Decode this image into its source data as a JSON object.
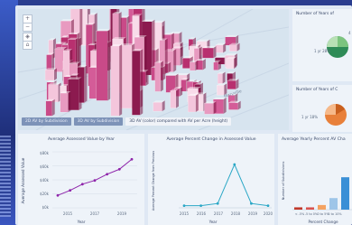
{
  "map": {
    "tabs": [
      "2D AV by Subdivision",
      "3D AV by Subdivision",
      "3D AV (color) compared with AV per Acre (height)"
    ],
    "active_tab": 2,
    "street_label": "Maryville"
  },
  "side_panels": {
    "top_title": "Number of Years of",
    "bottom_title": "Number of Years of C",
    "top_labels": [
      "1 yr 28%",
      "4 y"
    ],
    "bottom_labels": [
      "1 yr 18%"
    ]
  },
  "charts": {
    "c1": {
      "title": "Average Assessed Value by Year",
      "xlabel": "Year",
      "ylabel": "Average Assessed Value",
      "yticks": [
        "$80k",
        "$60k",
        "$40k",
        "$20k",
        "$0k"
      ],
      "xticks": [
        "2015",
        "2017",
        "2019"
      ]
    },
    "c2": {
      "title": "Average Percent Change in Assessed Value",
      "xlabel": "Year",
      "ylabel": "Average Percent Change from Previous",
      "xticks": [
        "2015",
        "2016",
        "2017",
        "2018",
        "2019",
        "2020"
      ]
    },
    "c3": {
      "title": "Average Yearly Percent AV Cha",
      "xlabel": "Percent Change",
      "ylabel": "Number of Subdivisions",
      "xticks": [
        "< -5%",
        "-5 to 0%",
        "0 to 5%",
        "5 to 10%"
      ]
    }
  },
  "chart_data": [
    {
      "type": "line",
      "title": "Average Assessed Value by Year",
      "xlabel": "Year",
      "ylabel": "Average Assessed Value",
      "x": [
        2014,
        2015,
        2016,
        2017,
        2018,
        2019,
        2020
      ],
      "values": [
        10,
        14,
        19,
        22,
        27,
        31,
        39
      ],
      "ylim": [
        0,
        45
      ]
    },
    {
      "type": "line",
      "title": "Average Percent Change in Assessed Value",
      "xlabel": "Year",
      "ylabel": "Average Percent Change from Previous",
      "x": [
        2015,
        2016,
        2017,
        2018,
        2019,
        2020
      ],
      "values": [
        1,
        1,
        2,
        20,
        2,
        1
      ],
      "ylim": [
        0,
        25
      ]
    },
    {
      "type": "bar",
      "title": "Average Yearly Percent AV Cha",
      "xlabel": "Percent Change",
      "ylabel": "Number of Subdivisions",
      "categories": [
        "< -5%",
        "-5 to 0%",
        "0 to 5%",
        "5 to 10%",
        "",
        ""
      ],
      "values": [
        1,
        1,
        2,
        5,
        14,
        25
      ],
      "colors": [
        "#c0392b",
        "#d9534f",
        "#f4a261",
        "#9ec5e8",
        "#3a8fd6",
        "#1f6fb8"
      ]
    }
  ]
}
